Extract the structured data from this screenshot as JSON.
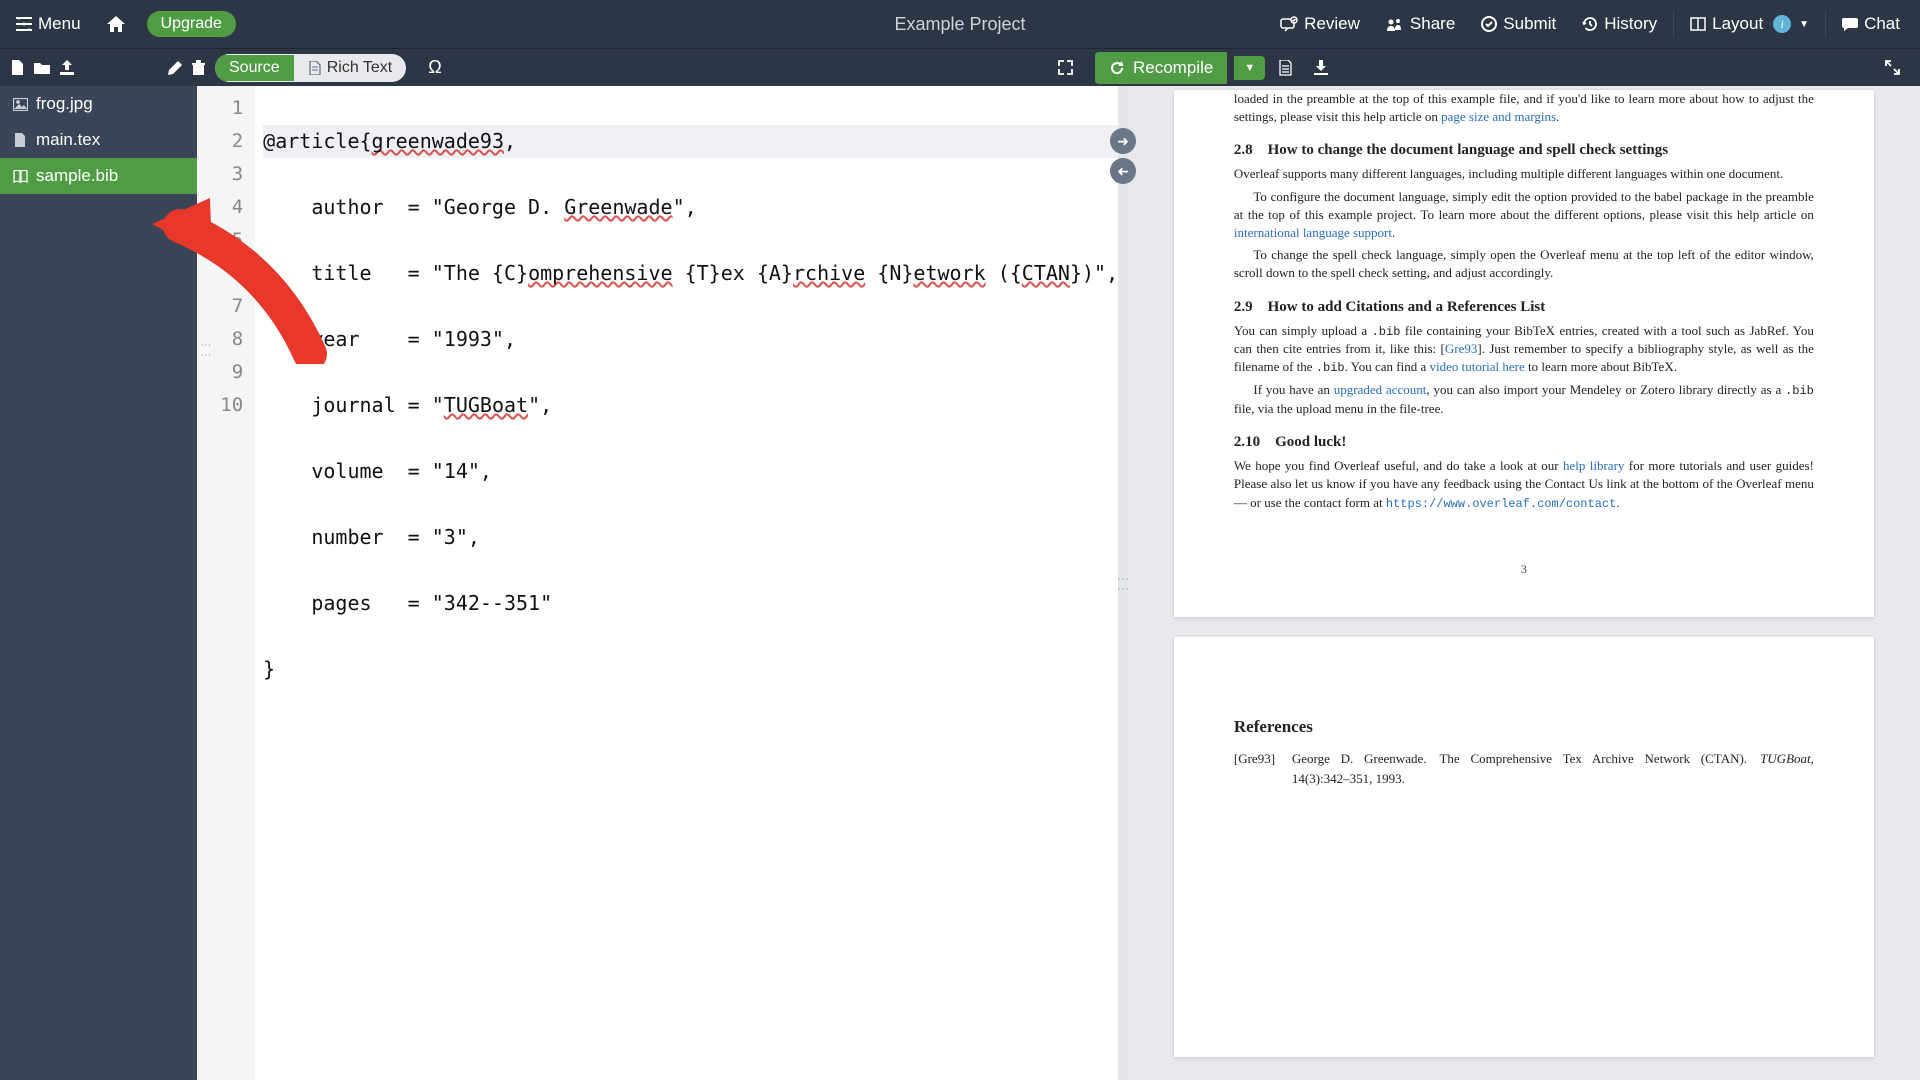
{
  "topbar": {
    "menu_label": "Menu",
    "upgrade_label": "Upgrade",
    "project_title": "Example Project",
    "review_label": "Review",
    "share_label": "Share",
    "submit_label": "Submit",
    "history_label": "History",
    "layout_label": "Layout",
    "chat_label": "Chat"
  },
  "subbar": {
    "source_label": "Source",
    "richtext_label": "Rich Text",
    "recompile_label": "Recompile"
  },
  "filetree": {
    "files": [
      {
        "name": "frog.jpg",
        "icon": "image"
      },
      {
        "name": "main.tex",
        "icon": "file"
      },
      {
        "name": "sample.bib",
        "icon": "book"
      }
    ],
    "active_index": 2
  },
  "editor": {
    "lines": [
      "@article{greenwade93,",
      "    author  = \"George D. Greenwade\",",
      "    title   = \"The {C}omprehensive {T}ex {A}rchive {N}etwork ({CTAN})\",",
      "    year    = \"1993\",",
      "    journal = \"TUGBoat\",",
      "    volume  = \"14\",",
      "    number  = \"3\",",
      "    pages   = \"342--351\"",
      "}",
      ""
    ]
  },
  "pdf": {
    "page1": {
      "intro_frag": "loaded in the preamble at the top of this example file, and if you'd like to learn more about how to adjust the settings, please visit this help article on ",
      "intro_link": "page size and margins",
      "s28_heading": "2.8 How to change the document language and spell check settings",
      "s28_p1": "Overleaf supports many different languages, including multiple different languages within one document.",
      "s28_p2a": "To configure the document language, simply edit the option provided to the babel package in the preamble at the top of this example project. To learn more about the different options, please visit this help article on ",
      "s28_p2_link": "international language support",
      "s28_p3": "To change the spell check language, simply open the Overleaf menu at the top left of the editor window, scroll down to the spell check setting, and adjust accordingly.",
      "s29_heading": "2.9 How to add Citations and a References List",
      "s29_p1a": "You can simply upload a ",
      "s29_p1_code1": ".bib",
      "s29_p1b": " file containing your BibTeX entries, created with a tool such as JabRef. You can then cite entries from it, like this: [",
      "s29_p1_cite": "Gre93",
      "s29_p1c": "]. Just remember to specify a bibliography style, as well as the filename of the ",
      "s29_p1_code2": ".bib",
      "s29_p1d": ". You can find a ",
      "s29_p1_link": "video tutorial here",
      "s29_p1e": " to learn more about BibTeX.",
      "s29_p2a": "If you have an ",
      "s29_p2_link": "upgraded account",
      "s29_p2b": ", you can also import your Mendeley or Zotero library directly as a ",
      "s29_p2_code": ".bib",
      "s29_p2c": " file, via the upload menu in the file-tree.",
      "s210_heading": "2.10 Good luck!",
      "s210_p1a": "We hope you find Overleaf useful, and do take a look at our ",
      "s210_p1_link": "help library",
      "s210_p1b": " for more tutorials and user guides! Please also let us know if you have any feedback using the Contact Us link at the bottom of the Overleaf menu — or use the contact form at ",
      "s210_p1_url": "https://www.overleaf.com/contact",
      "pagenum": "3"
    },
    "page2": {
      "ref_heading": "References",
      "ref_key": "[Gre93]",
      "ref_body_a": "George D. Greenwade. The Comprehensive Tex Archive Network (CTAN). ",
      "ref_body_journal": "TUGBoat",
      "ref_body_b": ", 14(3):342–351, 1993."
    }
  }
}
